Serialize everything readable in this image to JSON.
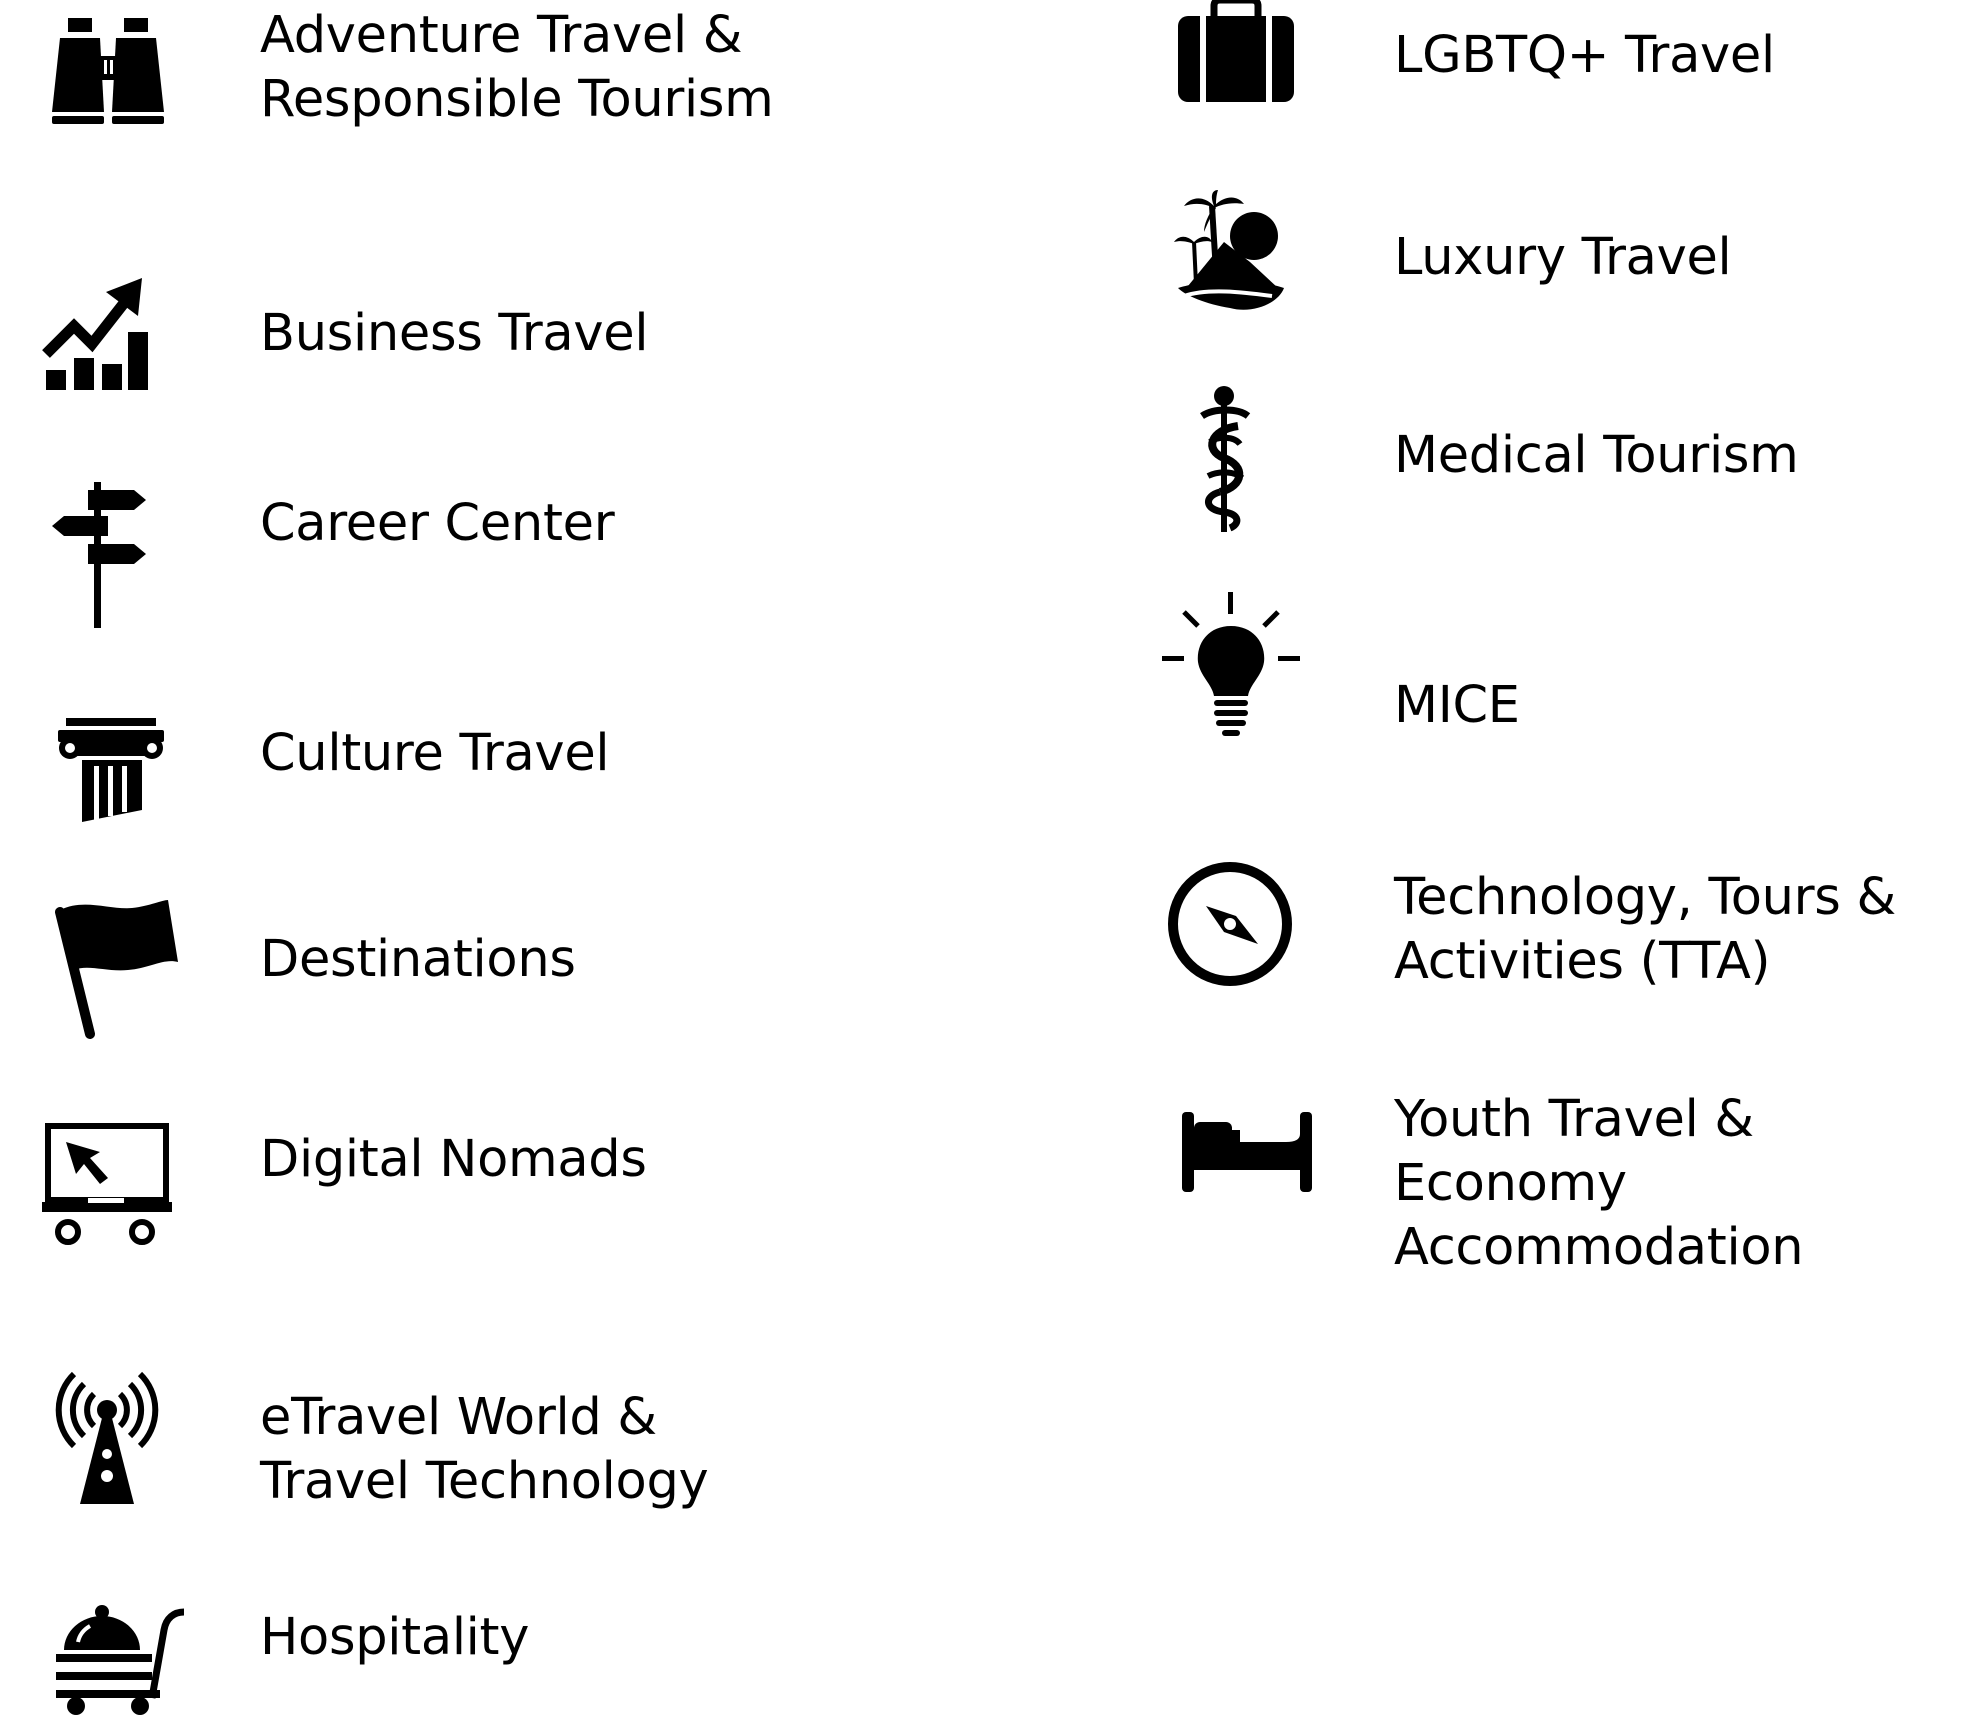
{
  "categories": {
    "left": [
      {
        "id": "adventure",
        "label": "Adventure Travel &\nResponsible Tourism",
        "icon": "binoculars-icon"
      },
      {
        "id": "business",
        "label": "Business Travel",
        "icon": "growth-chart-icon"
      },
      {
        "id": "career",
        "label": "Career Center",
        "icon": "signpost-icon"
      },
      {
        "id": "culture",
        "label": "Culture Travel",
        "icon": "column-icon"
      },
      {
        "id": "destinations",
        "label": "Destinations",
        "icon": "flag-icon"
      },
      {
        "id": "digital",
        "label": "Digital Nomads",
        "icon": "laptop-cart-icon"
      },
      {
        "id": "etravel",
        "label": "eTravel World &\nTravel Technology",
        "icon": "antenna-icon"
      },
      {
        "id": "hospitality",
        "label": "Hospitality",
        "icon": "room-service-cart-icon"
      }
    ],
    "right": [
      {
        "id": "lgbtq",
        "label": "LGBTQ+ Travel",
        "icon": "suitcase-icon"
      },
      {
        "id": "luxury",
        "label": "Luxury Travel",
        "icon": "island-icon"
      },
      {
        "id": "medical",
        "label": "Medical Tourism",
        "icon": "caduceus-icon"
      },
      {
        "id": "mice",
        "label": "MICE",
        "icon": "lightbulb-icon"
      },
      {
        "id": "tta",
        "label": "Technology, Tours &\nActivities (TTA)",
        "icon": "compass-icon"
      },
      {
        "id": "youth",
        "label": "Youth Travel & Economy\nAccommodation",
        "icon": "bed-icon"
      }
    ]
  },
  "colors": {
    "icon": "#000000",
    "text": "#000000",
    "background": "#ffffff"
  }
}
